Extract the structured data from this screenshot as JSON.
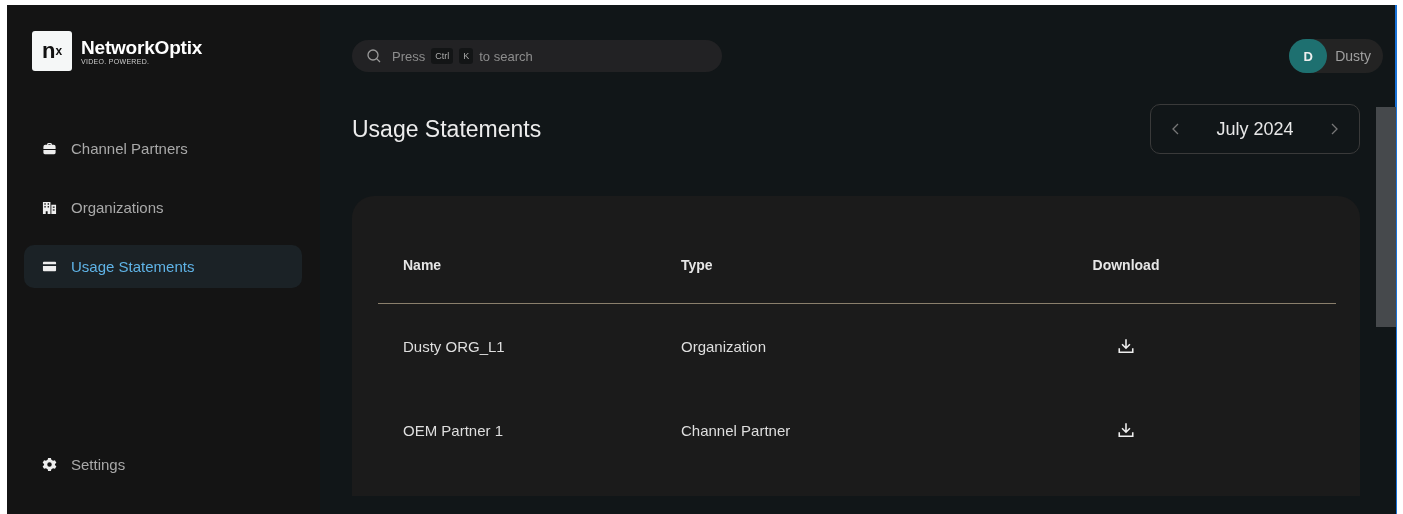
{
  "brand": {
    "mark": "n",
    "mark_sup": "x",
    "name": "NetworkOptix",
    "tagline": "VIDEO. POWERED."
  },
  "sidebar": {
    "items": [
      {
        "label": "Channel Partners",
        "selected": false
      },
      {
        "label": "Organizations",
        "selected": false
      },
      {
        "label": "Usage Statements",
        "selected": true
      }
    ],
    "footer_item": {
      "label": "Settings",
      "selected": false
    }
  },
  "search": {
    "placeholder_before": "Press",
    "keys": [
      "Ctrl",
      "K"
    ],
    "placeholder_after": "to search"
  },
  "user": {
    "initial": "D",
    "name": "Dusty"
  },
  "page": {
    "title": "Usage Statements",
    "month": "July 2024"
  },
  "table": {
    "columns": [
      "Name",
      "Type",
      "Download"
    ],
    "rows": [
      {
        "name": "Dusty ORG_L1",
        "type": "Organization"
      },
      {
        "name": "OEM Partner 1",
        "type": "Channel Partner"
      }
    ]
  }
}
